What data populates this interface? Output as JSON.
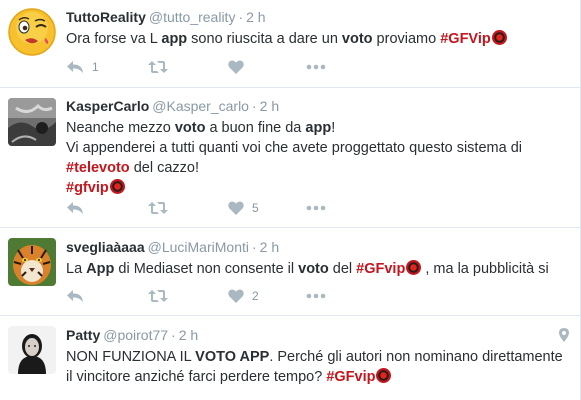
{
  "tweets": [
    {
      "fullname": "TuttoReality",
      "username": "@tutto_reality",
      "separator": "·",
      "time": "2 h",
      "segments": [
        {
          "t": "Ora forse va L "
        },
        {
          "t": "app",
          "b": true
        },
        {
          "t": " sono riuscita a dare un "
        },
        {
          "t": "voto",
          "b": true
        },
        {
          "t": " proviamo  "
        },
        {
          "t": "#GFVip",
          "h": true,
          "emoji": true
        }
      ],
      "reply_count": "1",
      "like_count": ""
    },
    {
      "fullname": "KasperCarlo",
      "username": "@Kasper_carlo",
      "separator": "·",
      "time": "2 h",
      "segments": [
        {
          "t": "Neanche mezzo "
        },
        {
          "t": "voto",
          "b": true
        },
        {
          "t": " a buon fine da "
        },
        {
          "t": "app",
          "b": true
        },
        {
          "t": "!",
          "br": true
        },
        {
          "t": "Vi appenderei a tutti quanti voi che avete proggettato questo sistema di",
          "br": true
        },
        {
          "t": "#televoto",
          "h": true
        },
        {
          "t": " del cazzo!",
          "br": true
        },
        {
          "t": "#gfvip",
          "h": true,
          "emoji": true
        }
      ],
      "reply_count": "",
      "like_count": "5"
    },
    {
      "fullname": "svegliaàaaa",
      "username": "@LuciMariMonti",
      "separator": "·",
      "time": "2 h",
      "segments": [
        {
          "t": "La "
        },
        {
          "t": "App",
          "b": true
        },
        {
          "t": " di Mediaset non consente il "
        },
        {
          "t": "voto",
          "b": true
        },
        {
          "t": " del "
        },
        {
          "t": "#GFvip",
          "h": true,
          "emoji": true
        },
        {
          "t": " , ma la pubblicità si"
        }
      ],
      "reply_count": "",
      "like_count": "2"
    },
    {
      "fullname": "Patty",
      "username": "@poirot77",
      "separator": "·",
      "time": "2 h",
      "segments": [
        {
          "t": "NON FUNZIONA IL "
        },
        {
          "t": "VOTO APP",
          "b": true
        },
        {
          "t": ". Perché gli autori non nominano direttamente",
          "br": true
        },
        {
          "t": "il vincitore anziché farci perdere tempo? "
        },
        {
          "t": "#GFvip",
          "h": true,
          "emoji": true
        }
      ],
      "reply_count": "",
      "like_count": ""
    }
  ]
}
